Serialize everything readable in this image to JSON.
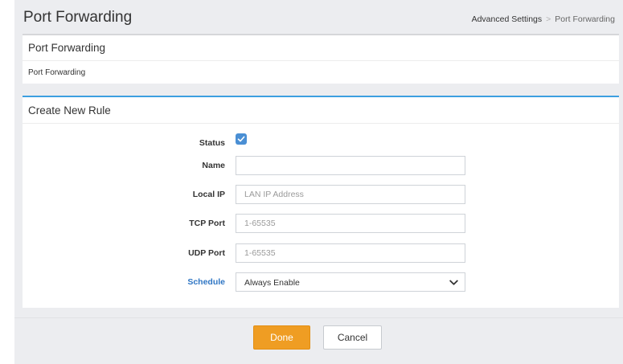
{
  "header": {
    "title": "Port Forwarding",
    "breadcrumb": {
      "parent": "Advanced Settings",
      "separator": ">",
      "current": "Port Forwarding"
    }
  },
  "panel1": {
    "title": "Port Forwarding",
    "body": "Port Forwarding"
  },
  "panel2": {
    "title": "Create New Rule",
    "fields": {
      "status": {
        "label": "Status",
        "checked": true
      },
      "name": {
        "label": "Name",
        "value": "",
        "placeholder": ""
      },
      "local_ip": {
        "label": "Local IP",
        "value": "",
        "placeholder": "LAN IP Address"
      },
      "tcp_port": {
        "label": "TCP Port",
        "value": "",
        "placeholder": "1-65535"
      },
      "udp_port": {
        "label": "UDP Port",
        "value": "",
        "placeholder": "1-65535"
      },
      "schedule": {
        "label": "Schedule",
        "selected": "Always Enable"
      }
    }
  },
  "buttons": {
    "done": "Done",
    "cancel": "Cancel"
  },
  "colors": {
    "accent_blue": "#3c9fe0",
    "checkbox": "#4a8fd4",
    "done_button": "#ef9d23",
    "link_label": "#2f76c4"
  }
}
